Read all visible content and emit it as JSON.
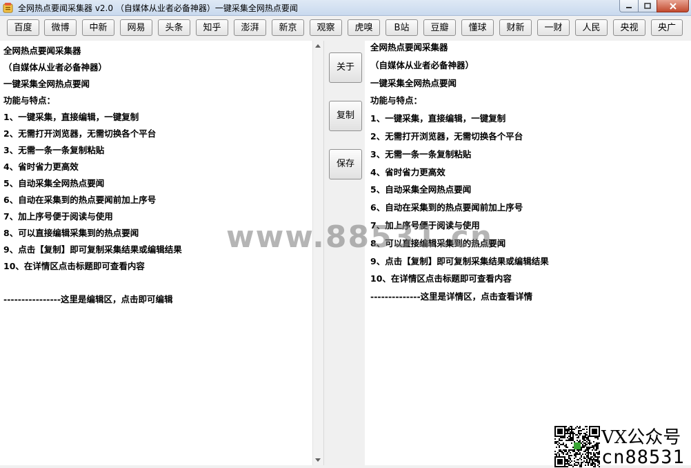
{
  "window": {
    "title": "全网热点要闻采集器  v2.0  （自媒体从业者必备神器）一键采集全网热点要闻"
  },
  "toolbar": {
    "sources": [
      "百度",
      "微博",
      "中新",
      "网易",
      "头条",
      "知乎",
      "澎湃",
      "新京",
      "观察",
      "虎嗅",
      "B站",
      "豆瓣",
      "懂球",
      "财新",
      "一财",
      "人民",
      "央视",
      "央广"
    ]
  },
  "side_buttons": {
    "about": "关于",
    "copy": "复制",
    "save": "保存"
  },
  "editor": {
    "lines": [
      "全网热点要闻采集器",
      "（自媒体从业者必备神器）",
      "一键采集全网热点要闻",
      "功能与特点：",
      "1、一键采集，直接编辑，一键复制",
      "2、无需打开浏览器，无需切换各个平台",
      "3、无需一条一条复制粘贴",
      "4、省时省力更高效",
      "5、自动采集全网热点要闻",
      "6、自动在采集到的热点要闻前加上序号",
      "7、加上序号便于阅读与使用",
      "8、可以直接编辑采集到的热点要闻",
      "9、点击【复制】即可复制采集结果或编辑结果",
      "10、在详情区点击标题即可查看内容",
      "",
      "----------------这里是编辑区，点击即可编辑"
    ]
  },
  "details": {
    "lines": [
      "全网热点要闻采集器",
      "（自媒体从业者必备神器）",
      "一键采集全网热点要闻",
      "功能与特点：",
      "1、一键采集，直接编辑，一键复制",
      "2、无需打开浏览器，无需切换各个平台",
      "3、无需一条一条复制粘贴",
      "4、省时省力更高效",
      "5、自动采集全网热点要闻",
      "6、自动在采集到的热点要闻前加上序号",
      "7、加上序号便于阅读与使用",
      "8、可以直接编辑采集到的热点要闻",
      "9、点击【复制】即可复制采集结果或编辑结果",
      "10、在详情区点击标题即可查看内容",
      "--------------这里是详情区，点击查看详情"
    ]
  },
  "overlay": {
    "watermark": "www.88531.cn",
    "vx": "VX公众号",
    "cn": "cn88531"
  }
}
